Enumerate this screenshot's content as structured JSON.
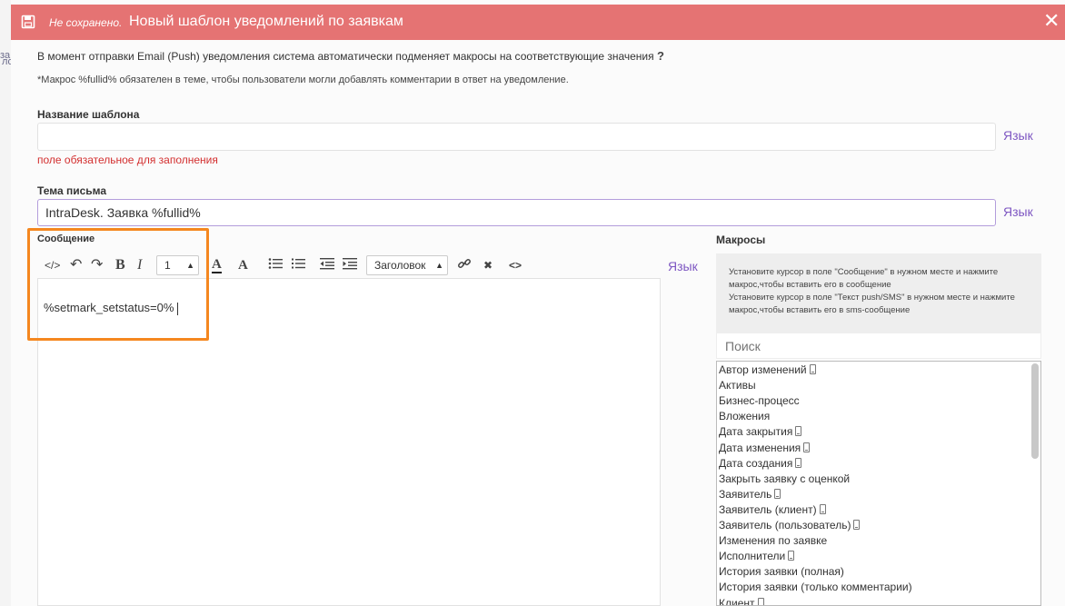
{
  "background": {
    "fragments": [
      "за",
      "ло"
    ]
  },
  "header": {
    "status": "Не сохранено.",
    "title": "Новый шаблон уведомлений по заявкам",
    "close": "✕"
  },
  "info": {
    "line1": "В момент отправки Email (Push) уведомления система автоматически подменяет макросы на соответствующие значения",
    "help": "?",
    "line2": "*Макрос %fullid% обязателен в теме, чтобы пользователи могли добавлять комментарии в ответ на уведомление."
  },
  "template_name": {
    "label": "Название шаблона",
    "value": "",
    "lang": "Язык",
    "error": "поле обязательное для заполнения"
  },
  "subject": {
    "label": "Тема письма",
    "value": "IntraDesk. Заявка %fullid%",
    "lang": "Язык"
  },
  "message": {
    "label": "Сообщение",
    "lang": "Язык",
    "toolbar": {
      "code": "</>",
      "undo": "↶",
      "redo": "↷",
      "bold": "B",
      "italic": "I",
      "font_size": "1",
      "font_color": "A",
      "bg_color": "A",
      "heading": "Заголовок",
      "link": "🔗",
      "clear": "✖",
      "source": "<>"
    },
    "content": "%setmark_setstatus=0%"
  },
  "macros": {
    "title": "Макросы",
    "hint1": "Установите курсор в поле \"Сообщение\" в нужном месте и нажмите макрос,чтобы вставить его в сообщение",
    "hint2": "Установите курсор в поле \"Текст push/SMS\" в нужном месте и нажмите макрос,чтобы вставить его в sms-сообщение",
    "search_placeholder": "Поиск",
    "items": [
      {
        "label": "Автор изменений",
        "phone": true
      },
      {
        "label": "Активы",
        "phone": false
      },
      {
        "label": "Бизнес-процесс",
        "phone": false
      },
      {
        "label": "Вложения",
        "phone": false
      },
      {
        "label": "Дата закрытия",
        "phone": true
      },
      {
        "label": "Дата изменения",
        "phone": true
      },
      {
        "label": "Дата создания",
        "phone": true
      },
      {
        "label": "Закрыть заявку с оценкой",
        "phone": false
      },
      {
        "label": "Заявитель",
        "phone": true
      },
      {
        "label": "Заявитель (клиент)",
        "phone": true
      },
      {
        "label": "Заявитель (пользователь)",
        "phone": true
      },
      {
        "label": "Изменения по заявке",
        "phone": false
      },
      {
        "label": "Исполнители",
        "phone": true
      },
      {
        "label": "История заявки (полная)",
        "phone": false
      },
      {
        "label": "История заявки (только комментарии)",
        "phone": false
      },
      {
        "label": "Клиент",
        "phone": true
      }
    ]
  }
}
